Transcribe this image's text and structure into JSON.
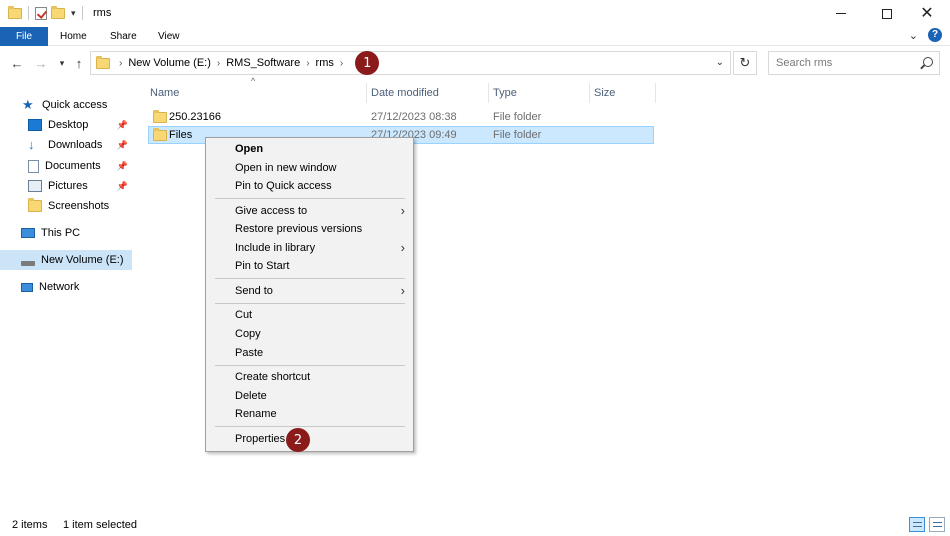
{
  "window": {
    "title": "rms",
    "icons": [
      "folder-icon",
      "properties-check-icon",
      "new-folder-icon",
      "customize-dropdown-icon"
    ]
  },
  "ribbon": {
    "tabs": [
      "File",
      "Home",
      "Share",
      "View"
    ],
    "accent": "#1a63b5"
  },
  "address": {
    "crumbs": [
      "New Volume (E:)",
      "RMS_Software",
      "rms"
    ],
    "badge": "1"
  },
  "search": {
    "placeholder": "Search rms"
  },
  "navpane": {
    "items": [
      {
        "label": "Quick access",
        "icon": "star-icon"
      },
      {
        "label": "Desktop",
        "icon": "desktop-icon",
        "pinned": true
      },
      {
        "label": "Downloads",
        "icon": "download-arrow-icon",
        "pinned": true
      },
      {
        "label": "Documents",
        "icon": "document-icon",
        "pinned": true
      },
      {
        "label": "Pictures",
        "icon": "pictures-icon",
        "pinned": true
      },
      {
        "label": "Screenshots",
        "icon": "folder-icon"
      },
      {
        "label": "This PC",
        "icon": "computer-icon"
      },
      {
        "label": "New Volume (E:)",
        "icon": "drive-icon",
        "selected": true
      },
      {
        "label": "Network",
        "icon": "network-icon"
      }
    ]
  },
  "columns": [
    "Name",
    "Date modified",
    "Type",
    "Size"
  ],
  "files": [
    {
      "name": "250.23166",
      "date": "27/12/2023 08:38",
      "type": "File folder",
      "size": ""
    },
    {
      "name": "Files",
      "date": "27/12/2023 09:49",
      "type": "File folder",
      "size": "",
      "selected": true
    }
  ],
  "context_menu": {
    "groups": [
      [
        {
          "label": "Open",
          "bold": true
        },
        {
          "label": "Open in new window"
        },
        {
          "label": "Pin to Quick access"
        }
      ],
      [
        {
          "label": "Give access to",
          "submenu": true
        },
        {
          "label": "Restore previous versions"
        },
        {
          "label": "Include in library",
          "submenu": true
        },
        {
          "label": "Pin to Start"
        }
      ],
      [
        {
          "label": "Send to",
          "submenu": true
        }
      ],
      [
        {
          "label": "Cut"
        },
        {
          "label": "Copy"
        },
        {
          "label": "Paste"
        }
      ],
      [
        {
          "label": "Create shortcut"
        },
        {
          "label": "Delete"
        },
        {
          "label": "Rename"
        }
      ],
      [
        {
          "label": "Properties"
        }
      ]
    ],
    "badge": "2"
  },
  "status": {
    "item_count": "2 items",
    "selection": "1 item selected"
  },
  "colors": {
    "selection": "#cce8ff",
    "nav_selection": "#cce4f7",
    "badge": "#8b1a1a",
    "folder": "#f8d775"
  }
}
